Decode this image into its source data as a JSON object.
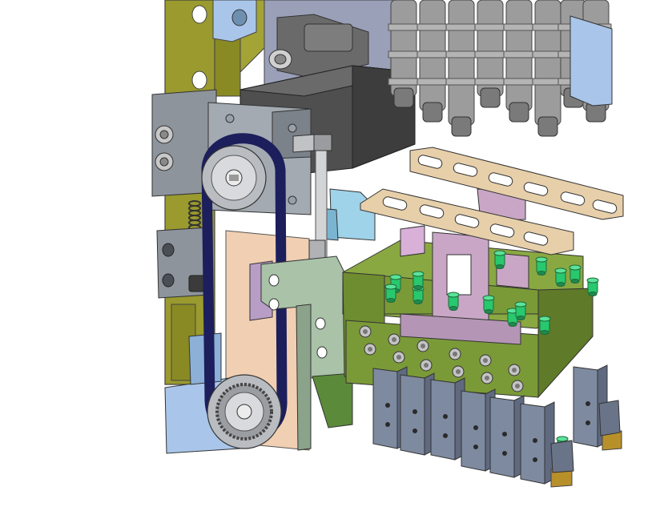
{
  "viewport": {
    "background": "#ffffff"
  },
  "colors": {
    "frame_olive": "#9a9a2e",
    "frame_olive_dark": "#6e6e1c",
    "block_grey": "#8e949c",
    "block_grey_dark": "#5d636b",
    "motor_dark": "#4a4a4a",
    "belt_navy": "#1c1f5c",
    "pulley_grey": "#b9bcc0",
    "plate_peach": "#f1cfb2",
    "bracket_lightblue": "#a9c6ea",
    "cover_skyblue": "#9fd3ea",
    "mount_sage": "#a9c2a8",
    "block_green": "#7a9a38",
    "plate_lilac": "#c9a6c6",
    "rail_tan": "#e7cfaa",
    "nozzle_green": "#28c86e",
    "cylinder_grey": "#9c9c9c",
    "fitting_brass": "#b8902a",
    "pad_slate": "#7e8aa0"
  },
  "icons": {
    "pulley": "pulley-icon",
    "screw": "screw-head-icon",
    "spring": "spring-icon",
    "nozzle": "suction-nozzle-icon"
  }
}
